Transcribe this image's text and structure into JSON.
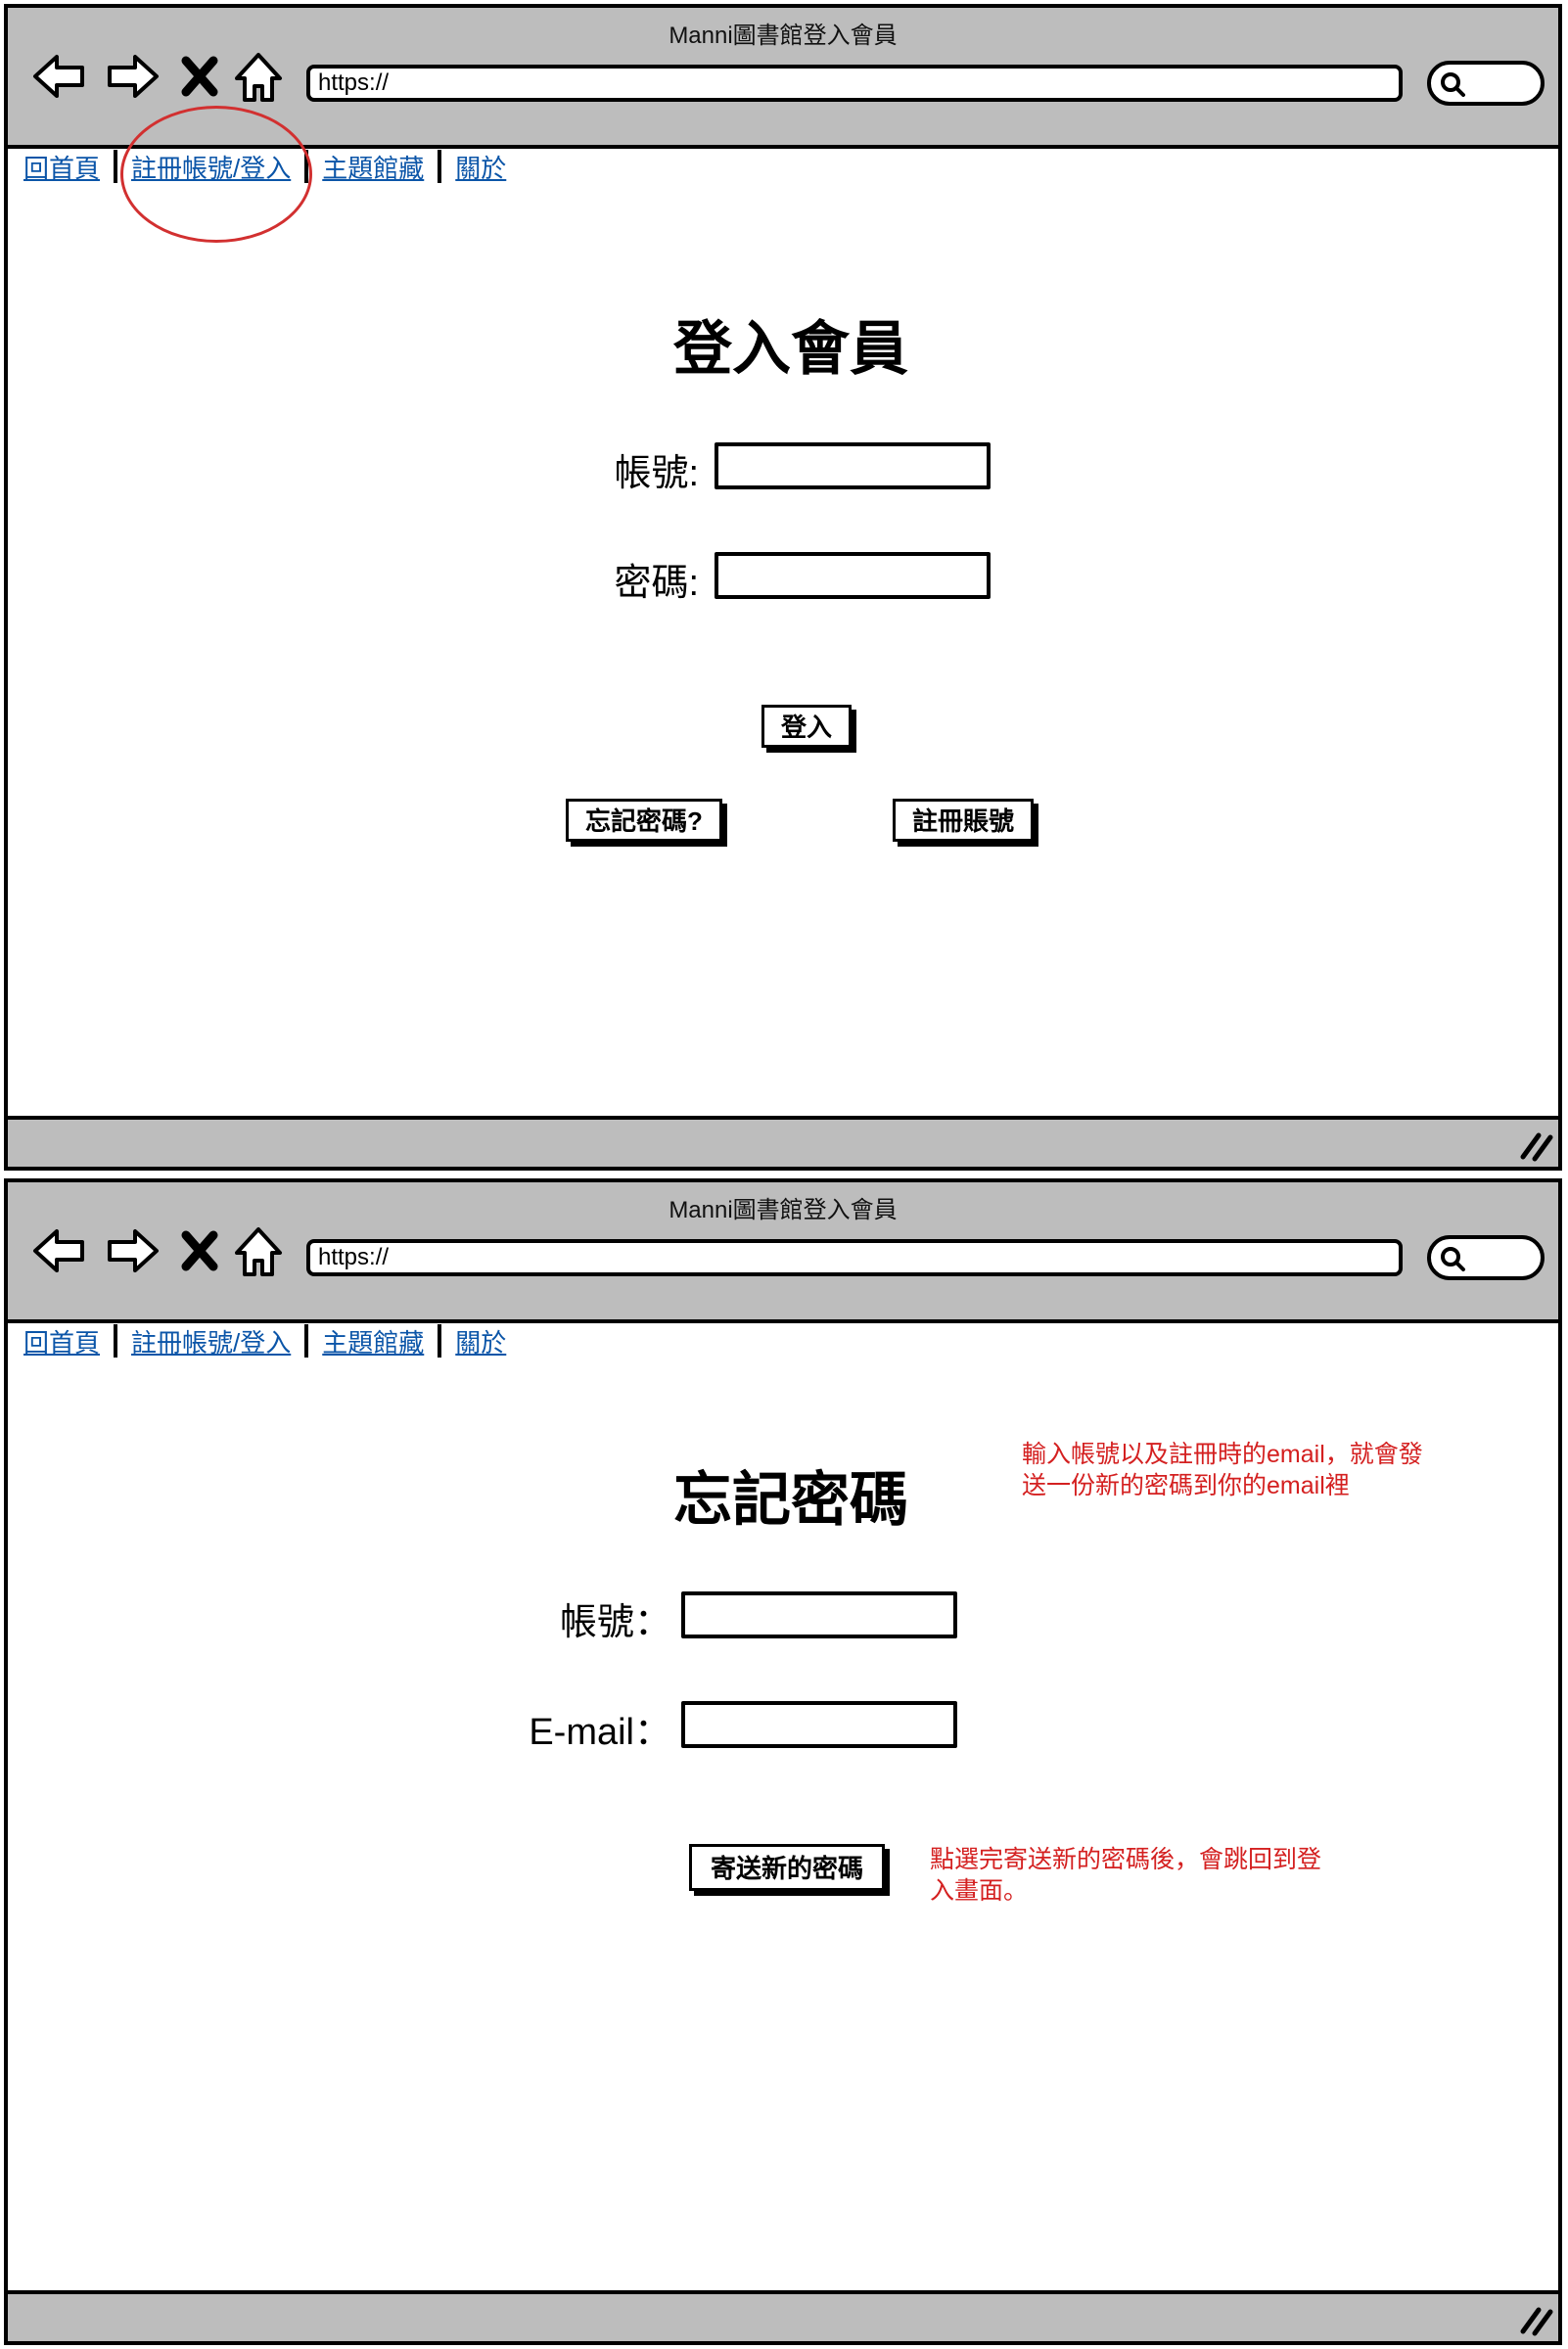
{
  "browser": {
    "window_title": "Manni圖書館登入會員",
    "url": "https://"
  },
  "nav_tabs": [
    "回首頁",
    "註冊帳號/登入",
    "主題館藏",
    "關於"
  ],
  "login_page": {
    "heading": "登入會員",
    "account_label": "帳號:",
    "password_label": "密碼:",
    "login_button": "登入",
    "forgot_button": "忘記密碼?",
    "register_button": "註冊賬號"
  },
  "forgot_page": {
    "heading": "忘記密碼",
    "account_label": "帳號：",
    "email_label": "E-mail：",
    "submit_button": "寄送新的密碼",
    "note_top_lines": [
      "輸入帳號以及註冊時的email，就會發",
      "送一份新的密碼到你的email裡"
    ],
    "note_bottom_lines": [
      "點選完寄送新的密碼後，會跳回到登",
      "入畫面。"
    ]
  },
  "colors": {
    "chrome_gray": "#bdbdbd",
    "link_blue": "#0b55a8",
    "annotation_red": "#d42020"
  }
}
